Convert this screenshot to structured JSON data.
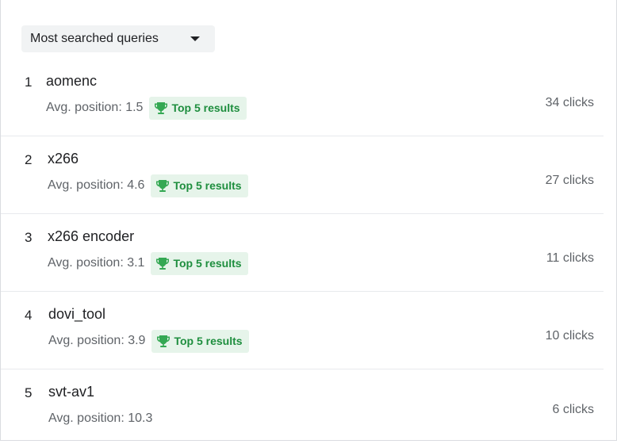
{
  "dropdown": {
    "label": "Most searched queries"
  },
  "badge_label": "Top 5 results",
  "queries": [
    {
      "rank": "1",
      "name": "aomenc",
      "avg": "Avg. position: 1.5",
      "top5": true,
      "clicks": "34 clicks"
    },
    {
      "rank": "2",
      "name": "x266",
      "avg": "Avg. position: 4.6",
      "top5": true,
      "clicks": "27 clicks"
    },
    {
      "rank": "3",
      "name": "x266 encoder",
      "avg": "Avg. position: 3.1",
      "top5": true,
      "clicks": "11 clicks"
    },
    {
      "rank": "4",
      "name": "dovi_tool",
      "avg": "Avg. position: 3.9",
      "top5": true,
      "clicks": "10 clicks"
    },
    {
      "rank": "5",
      "name": "svt-av1",
      "avg": "Avg. position: 10.3",
      "top5": false,
      "clicks": "6 clicks"
    }
  ],
  "colors": {
    "badge_bg": "#e6f4ea",
    "badge_text": "#1e8e3e",
    "trophy": "#34a853"
  }
}
